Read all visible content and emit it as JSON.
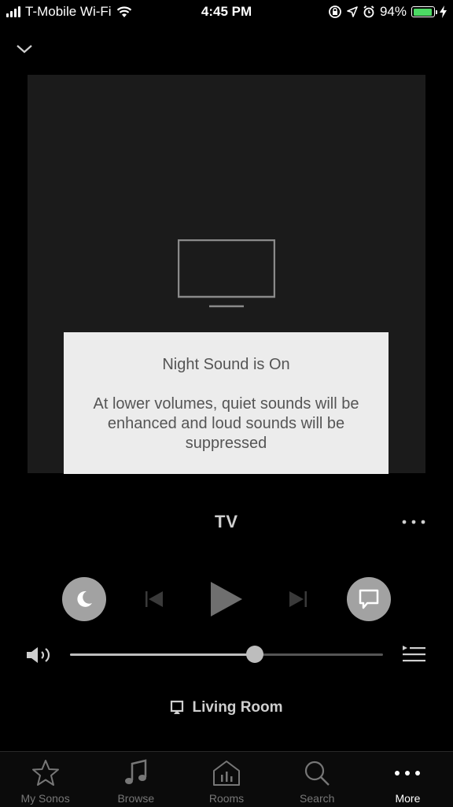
{
  "status_bar": {
    "carrier": "T-Mobile Wi-Fi",
    "time": "4:45 PM",
    "battery_percent": "94%",
    "battery_level": 0.94,
    "icons": [
      "signal-icon",
      "wifi-icon",
      "screen-lock-icon",
      "location-icon",
      "alarm-icon",
      "battery-icon",
      "charging-icon"
    ]
  },
  "toast": {
    "title": "Night Sound is On",
    "body": "At lower volumes, quiet sounds will be enhanced and loud sounds will be suppressed"
  },
  "now_playing": {
    "title": "TV",
    "room": "Living Room",
    "volume_level": 0.59
  },
  "tabs": [
    {
      "label": "My Sonos",
      "icon": "star-icon",
      "active": false
    },
    {
      "label": "Browse",
      "icon": "music-note-icon",
      "active": false
    },
    {
      "label": "Rooms",
      "icon": "house-icon",
      "active": false
    },
    {
      "label": "Search",
      "icon": "search-icon",
      "active": false
    },
    {
      "label": "More",
      "icon": "more-dots-icon",
      "active": true
    }
  ],
  "colors": {
    "background": "#000000",
    "artwork": "#1b1b1b",
    "toast": "#ececec",
    "button_gray": "#a2a2a2",
    "battery_green": "#4cd964"
  }
}
